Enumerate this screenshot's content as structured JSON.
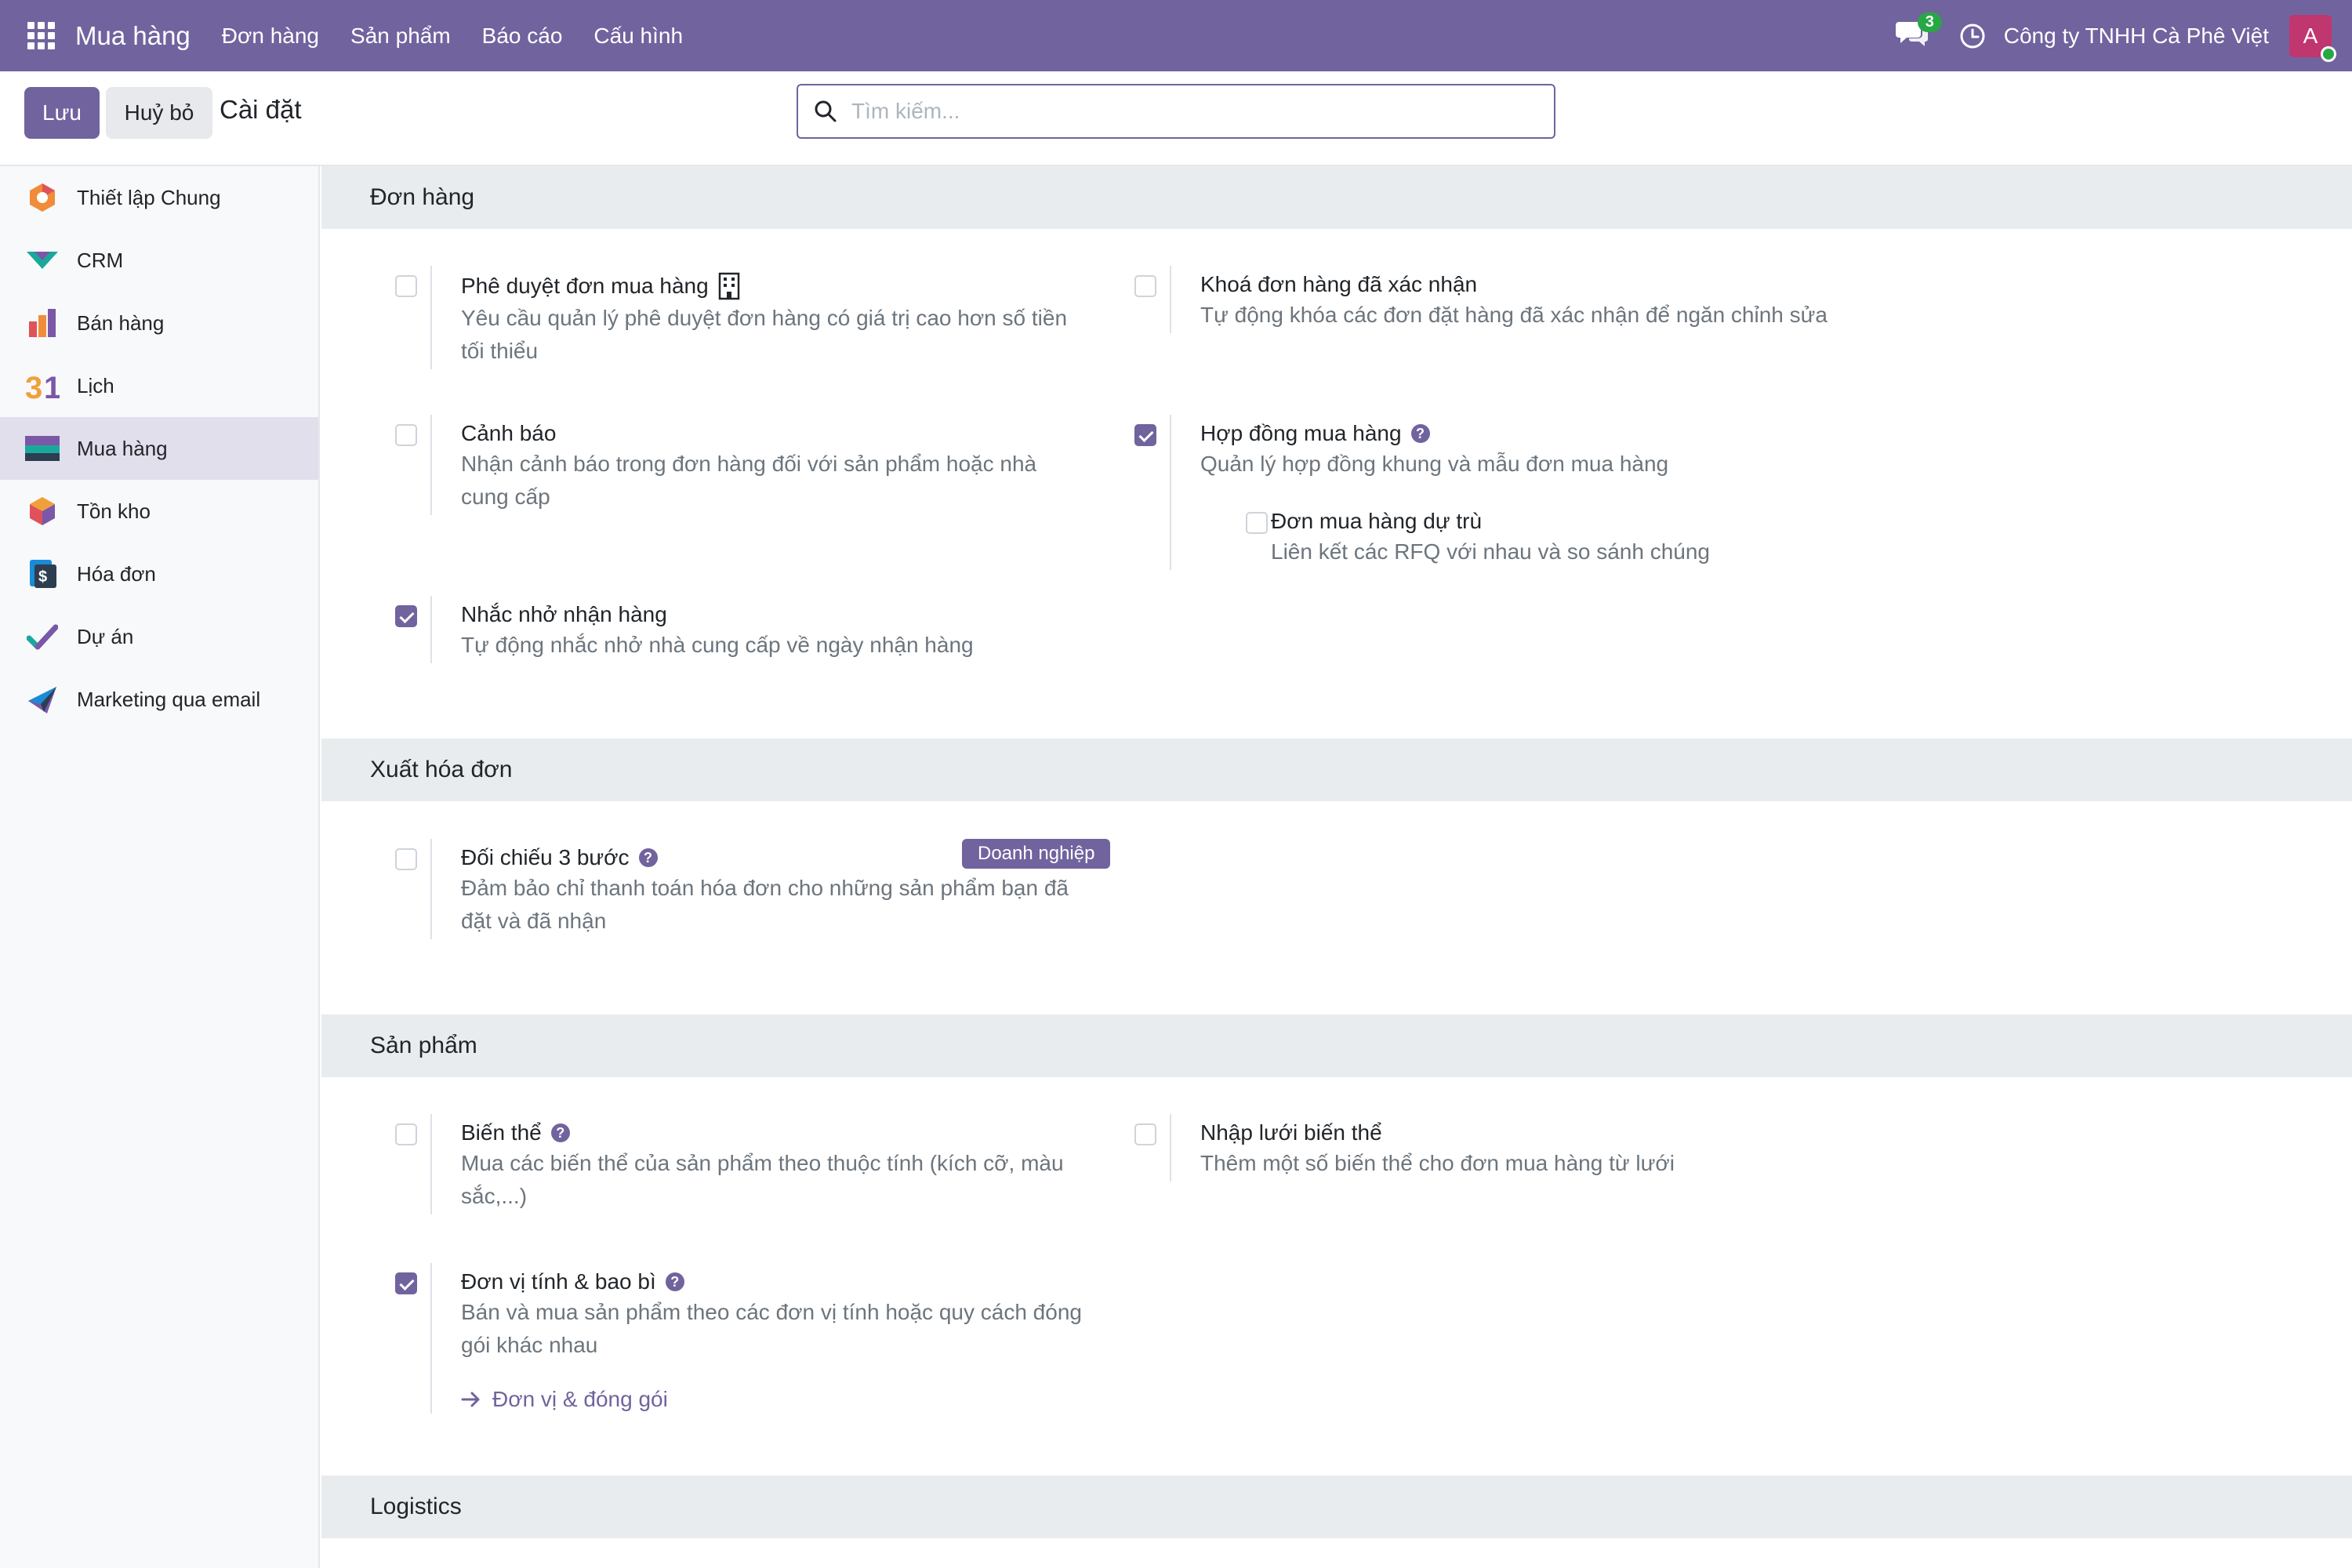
{
  "topbar": {
    "app_name": "Mua hàng",
    "menu": [
      "Đơn hàng",
      "Sản phẩm",
      "Báo cáo",
      "Cấu hình"
    ],
    "chat_count": "3",
    "company": "Công ty TNHH Cà Phê Việt",
    "avatar_letter": "A"
  },
  "controlpanel": {
    "save_label": "Lưu",
    "cancel_label": "Huỷ bỏ",
    "title": "Cài đặt",
    "search_placeholder": "Tìm kiếm..."
  },
  "sidebar": {
    "items": [
      {
        "label": "Thiết lập Chung",
        "icon": "general-settings-icon"
      },
      {
        "label": "CRM",
        "icon": "crm-icon"
      },
      {
        "label": "Bán hàng",
        "icon": "sales-icon"
      },
      {
        "label": "Lịch",
        "icon": "calendar-icon"
      },
      {
        "label": "Mua hàng",
        "icon": "purchase-icon",
        "active": true
      },
      {
        "label": "Tồn kho",
        "icon": "inventory-icon"
      },
      {
        "label": "Hóa đơn",
        "icon": "invoicing-icon"
      },
      {
        "label": "Dự án",
        "icon": "project-icon"
      },
      {
        "label": "Marketing qua email",
        "icon": "email-marketing-icon"
      }
    ]
  },
  "sections": {
    "orders": {
      "title": "Đơn hàng",
      "po_approval": {
        "title": "Phê duyệt đơn mua hàng",
        "desc": "Yêu cầu quản lý phê duyệt đơn hàng có giá trị cao hơn số tiền tối thiểu",
        "checked": false
      },
      "lock_orders": {
        "title": "Khoá đơn hàng đã xác nhận",
        "desc": "Tự động khóa các đơn đặt hàng đã xác nhận để ngăn chỉnh sửa",
        "checked": false
      },
      "warnings": {
        "title": "Cảnh báo",
        "desc": "Nhận cảnh báo trong đơn hàng đối với sản phẩm hoặc nhà cung cấp",
        "checked": false
      },
      "agreements": {
        "title": "Hợp đồng mua hàng",
        "desc": "Quản lý hợp đồng khung và mẫu đơn mua hàng",
        "checked": true
      },
      "alternatives": {
        "title": "Đơn mua hàng dự trù",
        "desc": "Liên kết các RFQ với nhau và so sánh chúng",
        "checked": false
      },
      "receipt_reminder": {
        "title": "Nhắc nhở nhận hàng",
        "desc": "Tự động nhắc nhở nhà cung cấp về ngày nhận hàng",
        "checked": true
      }
    },
    "invoicing": {
      "title": "Xuất hóa đơn",
      "three_way": {
        "title": "Đối chiếu 3 bước",
        "badge": "Doanh nghiệp",
        "desc": "Đảm bảo chỉ thanh toán hóa đơn cho những sản phẩm bạn đã đặt và đã nhận",
        "checked": false
      }
    },
    "products": {
      "title": "Sản phẩm",
      "variants": {
        "title": "Biến thể",
        "desc": "Mua các biến thể của sản phẩm theo thuộc tính (kích cỡ, màu sắc,...)",
        "checked": false
      },
      "variant_grid": {
        "title": "Nhập lưới biến thể",
        "desc": "Thêm một số biến thể cho đơn mua hàng từ lưới",
        "checked": false
      },
      "uom": {
        "title": "Đơn vị tính & bao bì",
        "desc": "Bán và mua sản phẩm theo các đơn vị tính hoặc quy cách đóng gói khác nhau",
        "checked": true,
        "link": "Đơn vị & đóng gói"
      }
    },
    "logistics": {
      "title": "Logistics"
    }
  },
  "colors": {
    "brand": "#71639e",
    "navbar": "#71639e",
    "section_bg": "#e9ecef",
    "chat_badge": "#28a745"
  }
}
